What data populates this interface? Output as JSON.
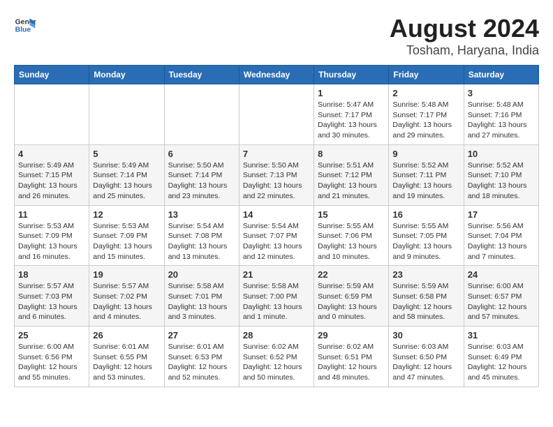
{
  "header": {
    "logo_line1": "General",
    "logo_line2": "Blue",
    "title": "August 2024",
    "subtitle": "Tosham, Haryana, India"
  },
  "days_of_week": [
    "Sunday",
    "Monday",
    "Tuesday",
    "Wednesday",
    "Thursday",
    "Friday",
    "Saturday"
  ],
  "weeks": [
    {
      "days": [
        {
          "num": "",
          "info": ""
        },
        {
          "num": "",
          "info": ""
        },
        {
          "num": "",
          "info": ""
        },
        {
          "num": "",
          "info": ""
        },
        {
          "num": "1",
          "info": "Sunrise: 5:47 AM\nSunset: 7:17 PM\nDaylight: 13 hours\nand 30 minutes."
        },
        {
          "num": "2",
          "info": "Sunrise: 5:48 AM\nSunset: 7:17 PM\nDaylight: 13 hours\nand 29 minutes."
        },
        {
          "num": "3",
          "info": "Sunrise: 5:48 AM\nSunset: 7:16 PM\nDaylight: 13 hours\nand 27 minutes."
        }
      ]
    },
    {
      "days": [
        {
          "num": "4",
          "info": "Sunrise: 5:49 AM\nSunset: 7:15 PM\nDaylight: 13 hours\nand 26 minutes."
        },
        {
          "num": "5",
          "info": "Sunrise: 5:49 AM\nSunset: 7:14 PM\nDaylight: 13 hours\nand 25 minutes."
        },
        {
          "num": "6",
          "info": "Sunrise: 5:50 AM\nSunset: 7:14 PM\nDaylight: 13 hours\nand 23 minutes."
        },
        {
          "num": "7",
          "info": "Sunrise: 5:50 AM\nSunset: 7:13 PM\nDaylight: 13 hours\nand 22 minutes."
        },
        {
          "num": "8",
          "info": "Sunrise: 5:51 AM\nSunset: 7:12 PM\nDaylight: 13 hours\nand 21 minutes."
        },
        {
          "num": "9",
          "info": "Sunrise: 5:52 AM\nSunset: 7:11 PM\nDaylight: 13 hours\nand 19 minutes."
        },
        {
          "num": "10",
          "info": "Sunrise: 5:52 AM\nSunset: 7:10 PM\nDaylight: 13 hours\nand 18 minutes."
        }
      ]
    },
    {
      "days": [
        {
          "num": "11",
          "info": "Sunrise: 5:53 AM\nSunset: 7:09 PM\nDaylight: 13 hours\nand 16 minutes."
        },
        {
          "num": "12",
          "info": "Sunrise: 5:53 AM\nSunset: 7:09 PM\nDaylight: 13 hours\nand 15 minutes."
        },
        {
          "num": "13",
          "info": "Sunrise: 5:54 AM\nSunset: 7:08 PM\nDaylight: 13 hours\nand 13 minutes."
        },
        {
          "num": "14",
          "info": "Sunrise: 5:54 AM\nSunset: 7:07 PM\nDaylight: 13 hours\nand 12 minutes."
        },
        {
          "num": "15",
          "info": "Sunrise: 5:55 AM\nSunset: 7:06 PM\nDaylight: 13 hours\nand 10 minutes."
        },
        {
          "num": "16",
          "info": "Sunrise: 5:55 AM\nSunset: 7:05 PM\nDaylight: 13 hours\nand 9 minutes."
        },
        {
          "num": "17",
          "info": "Sunrise: 5:56 AM\nSunset: 7:04 PM\nDaylight: 13 hours\nand 7 minutes."
        }
      ]
    },
    {
      "days": [
        {
          "num": "18",
          "info": "Sunrise: 5:57 AM\nSunset: 7:03 PM\nDaylight: 13 hours\nand 6 minutes."
        },
        {
          "num": "19",
          "info": "Sunrise: 5:57 AM\nSunset: 7:02 PM\nDaylight: 13 hours\nand 4 minutes."
        },
        {
          "num": "20",
          "info": "Sunrise: 5:58 AM\nSunset: 7:01 PM\nDaylight: 13 hours\nand 3 minutes."
        },
        {
          "num": "21",
          "info": "Sunrise: 5:58 AM\nSunset: 7:00 PM\nDaylight: 13 hours\nand 1 minute."
        },
        {
          "num": "22",
          "info": "Sunrise: 5:59 AM\nSunset: 6:59 PM\nDaylight: 13 hours\nand 0 minutes."
        },
        {
          "num": "23",
          "info": "Sunrise: 5:59 AM\nSunset: 6:58 PM\nDaylight: 12 hours\nand 58 minutes."
        },
        {
          "num": "24",
          "info": "Sunrise: 6:00 AM\nSunset: 6:57 PM\nDaylight: 12 hours\nand 57 minutes."
        }
      ]
    },
    {
      "days": [
        {
          "num": "25",
          "info": "Sunrise: 6:00 AM\nSunset: 6:56 PM\nDaylight: 12 hours\nand 55 minutes."
        },
        {
          "num": "26",
          "info": "Sunrise: 6:01 AM\nSunset: 6:55 PM\nDaylight: 12 hours\nand 53 minutes."
        },
        {
          "num": "27",
          "info": "Sunrise: 6:01 AM\nSunset: 6:53 PM\nDaylight: 12 hours\nand 52 minutes."
        },
        {
          "num": "28",
          "info": "Sunrise: 6:02 AM\nSunset: 6:52 PM\nDaylight: 12 hours\nand 50 minutes."
        },
        {
          "num": "29",
          "info": "Sunrise: 6:02 AM\nSunset: 6:51 PM\nDaylight: 12 hours\nand 48 minutes."
        },
        {
          "num": "30",
          "info": "Sunrise: 6:03 AM\nSunset: 6:50 PM\nDaylight: 12 hours\nand 47 minutes."
        },
        {
          "num": "31",
          "info": "Sunrise: 6:03 AM\nSunset: 6:49 PM\nDaylight: 12 hours\nand 45 minutes."
        }
      ]
    }
  ]
}
